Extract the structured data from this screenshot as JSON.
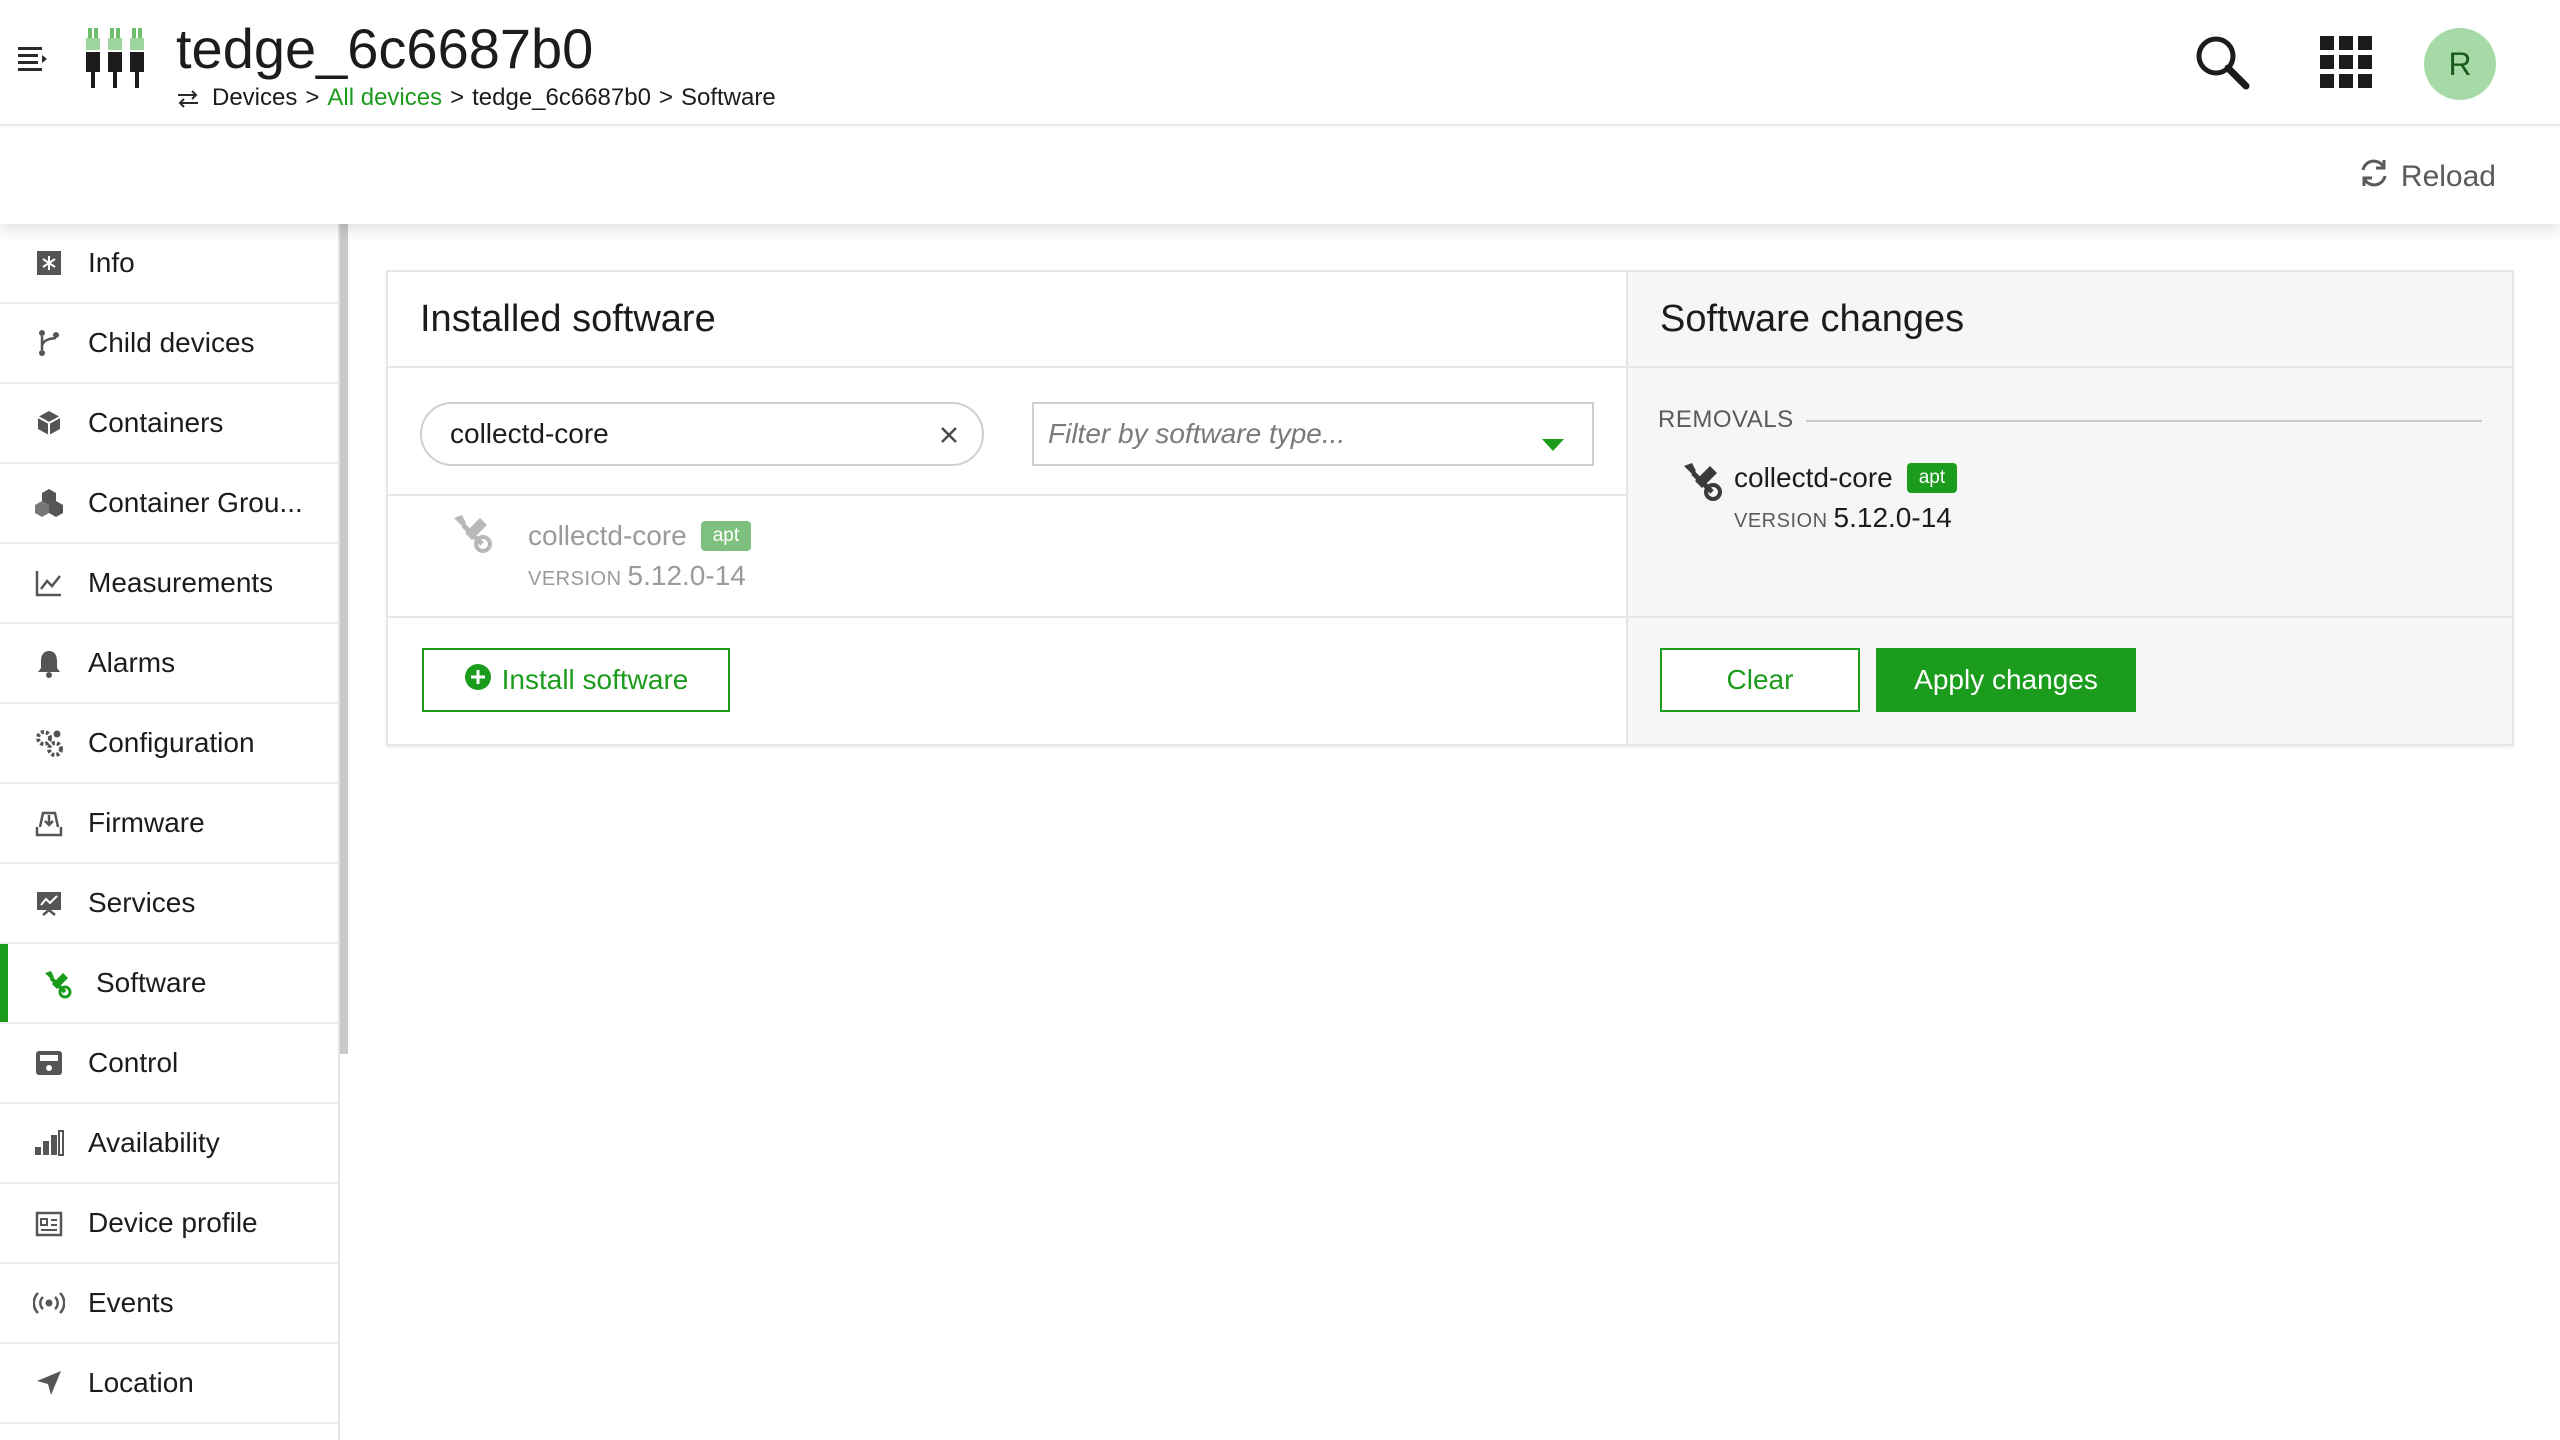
{
  "header": {
    "device_name": "tedge_6c6687b0",
    "breadcrumb": [
      {
        "label": "Devices",
        "link": false
      },
      {
        "label": ">",
        "link": false
      },
      {
        "label": "All devices",
        "link": true
      },
      {
        "label": ">",
        "link": false
      },
      {
        "label": "tedge_6c6687b0",
        "link": false
      },
      {
        "label": ">",
        "link": false
      },
      {
        "label": "Software",
        "link": false
      }
    ],
    "user_initial": "R",
    "icons": [
      "menu-icon",
      "device-icon",
      "swap-icon",
      "search-icon",
      "apps-grid-icon"
    ]
  },
  "actionbar": {
    "reload_label": "Reload"
  },
  "sidebar": {
    "items": [
      {
        "label": "Info",
        "icon": "info-icon",
        "active": false
      },
      {
        "label": "Child devices",
        "icon": "child-devices-icon",
        "active": false
      },
      {
        "label": "Containers",
        "icon": "container-icon",
        "active": false
      },
      {
        "label": "Container Grou...",
        "icon": "container-group-icon",
        "active": false
      },
      {
        "label": "Measurements",
        "icon": "line-chart-icon",
        "active": false
      },
      {
        "label": "Alarms",
        "icon": "bell-icon",
        "active": false
      },
      {
        "label": "Configuration",
        "icon": "gears-icon",
        "active": false
      },
      {
        "label": "Firmware",
        "icon": "firmware-icon",
        "active": false
      },
      {
        "label": "Services",
        "icon": "services-icon",
        "active": false
      },
      {
        "label": "Software",
        "icon": "software-icon",
        "active": true
      },
      {
        "label": "Control",
        "icon": "control-icon",
        "active": false
      },
      {
        "label": "Availability",
        "icon": "bar-chart-icon",
        "active": false
      },
      {
        "label": "Device profile",
        "icon": "device-profile-icon",
        "active": false
      },
      {
        "label": "Events",
        "icon": "broadcast-icon",
        "active": false
      },
      {
        "label": "Location",
        "icon": "location-arrow-icon",
        "active": false
      }
    ]
  },
  "installed": {
    "title": "Installed software",
    "search_value": "collectd-core",
    "filter_placeholder": "Filter by software type...",
    "items": [
      {
        "name": "collectd-core",
        "type": "apt",
        "version_label": "VERSION",
        "version": "5.12.0-14"
      }
    ],
    "install_button": "Install software"
  },
  "changes": {
    "title": "Software changes",
    "removals_label": "REMOVALS",
    "items": [
      {
        "name": "collectd-core",
        "type": "apt",
        "version_label": "VERSION",
        "version": "5.12.0-14"
      }
    ],
    "clear_button": "Clear",
    "apply_button": "Apply changes"
  },
  "colors": {
    "accent": "#1c9c1c",
    "badge_faded": "#7ec07d",
    "avatar_bg": "#a7d9a6"
  }
}
